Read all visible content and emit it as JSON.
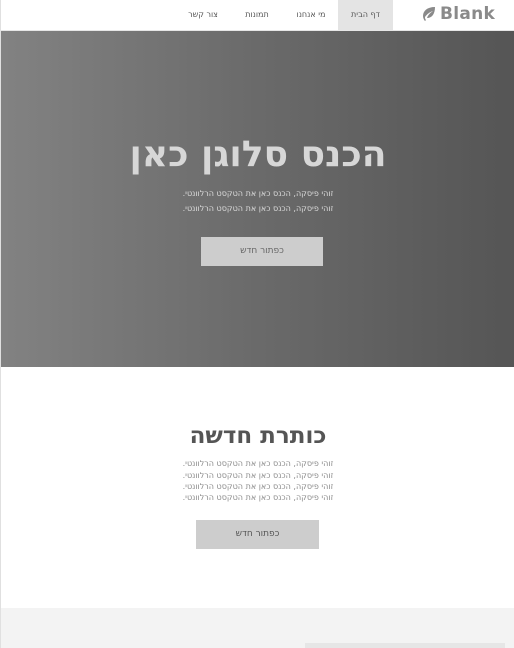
{
  "header": {
    "logo_text": "Blank",
    "nav": [
      {
        "label": "דף הבית",
        "active": true
      },
      {
        "label": "מי אנחנו",
        "active": false
      },
      {
        "label": "תמונות",
        "active": false
      },
      {
        "label": "צור קשר",
        "active": false
      }
    ]
  },
  "hero": {
    "title": "הכנס סלוגן כאן",
    "lines": [
      "זוהי פיסקה, הכנס כאן את הטקסט הרלוונטי.",
      "זוהי פיסקה, הכנס כאן את הטקסט הרלוונטי."
    ],
    "button_label": "כפתור חדש"
  },
  "section2": {
    "title": "כותרת חדשה",
    "lines": [
      "זוהי פיסקה, הכנס כאן את הטקסט הרלוונטי.",
      "זוהי פיסקה, הכנס כאן את הטקסט הרלוונטי.",
      "זוהי פיסקה, הכנס כאן את הטקסט הרלוונטי.",
      "זוהי פיסקה, הכנס כאן את הטקסט הרלוונטי."
    ],
    "button_label": "כפתור חדש"
  },
  "icons": {
    "logo": "leaf-icon"
  },
  "colors": {
    "hero_gradient_start": "#828282",
    "hero_gradient_end": "#555555",
    "button_bg": "#cdcdcd",
    "nav_active_bg": "#e4e4e4"
  }
}
